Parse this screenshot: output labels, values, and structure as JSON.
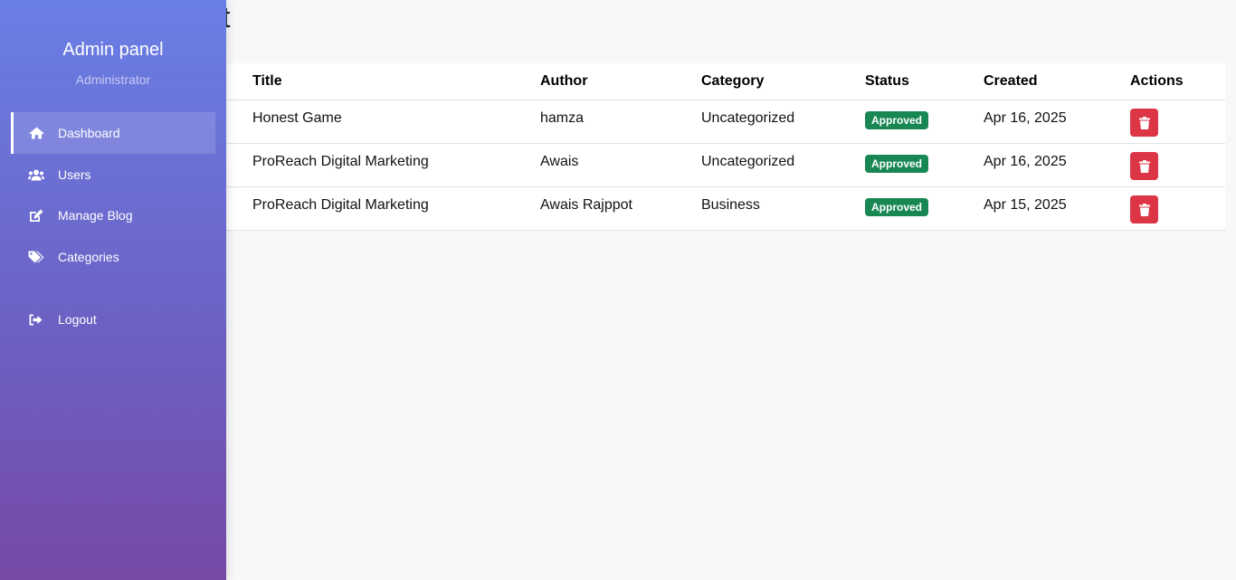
{
  "page": {
    "title": "agement"
  },
  "sidebar": {
    "brand": "Admin panel",
    "role": "Administrator",
    "items": [
      {
        "label": "Dashboard",
        "icon": "home-icon",
        "active": true
      },
      {
        "label": "Users",
        "icon": "users-icon",
        "active": false
      },
      {
        "label": "Manage Blog",
        "icon": "edit-icon",
        "active": false
      },
      {
        "label": "Categories",
        "icon": "tags-icon",
        "active": false
      },
      {
        "label": "Logout",
        "icon": "logout-icon",
        "active": false
      }
    ]
  },
  "table": {
    "headers": {
      "title": "Title",
      "author": "Author",
      "category": "Category",
      "status": "Status",
      "created": "Created",
      "actions": "Actions"
    },
    "rows": [
      {
        "title": "Honest Game",
        "author": "hamza",
        "category": "Uncategorized",
        "status": "Approved",
        "created": "Apr 16, 2025"
      },
      {
        "title": "ProReach Digital Marketing",
        "author": "Awais",
        "category": "Uncategorized",
        "status": "Approved",
        "created": "Apr 16, 2025"
      },
      {
        "title": "ProReach Digital Marketing",
        "author": "Awais Rajppot",
        "category": "Business",
        "status": "Approved",
        "created": "Apr 15, 2025"
      }
    ]
  },
  "colors": {
    "approved": "#198754",
    "delete": "#dc3545",
    "sidebar_top": "#6a7fe6",
    "sidebar_bottom": "#7649a6"
  }
}
